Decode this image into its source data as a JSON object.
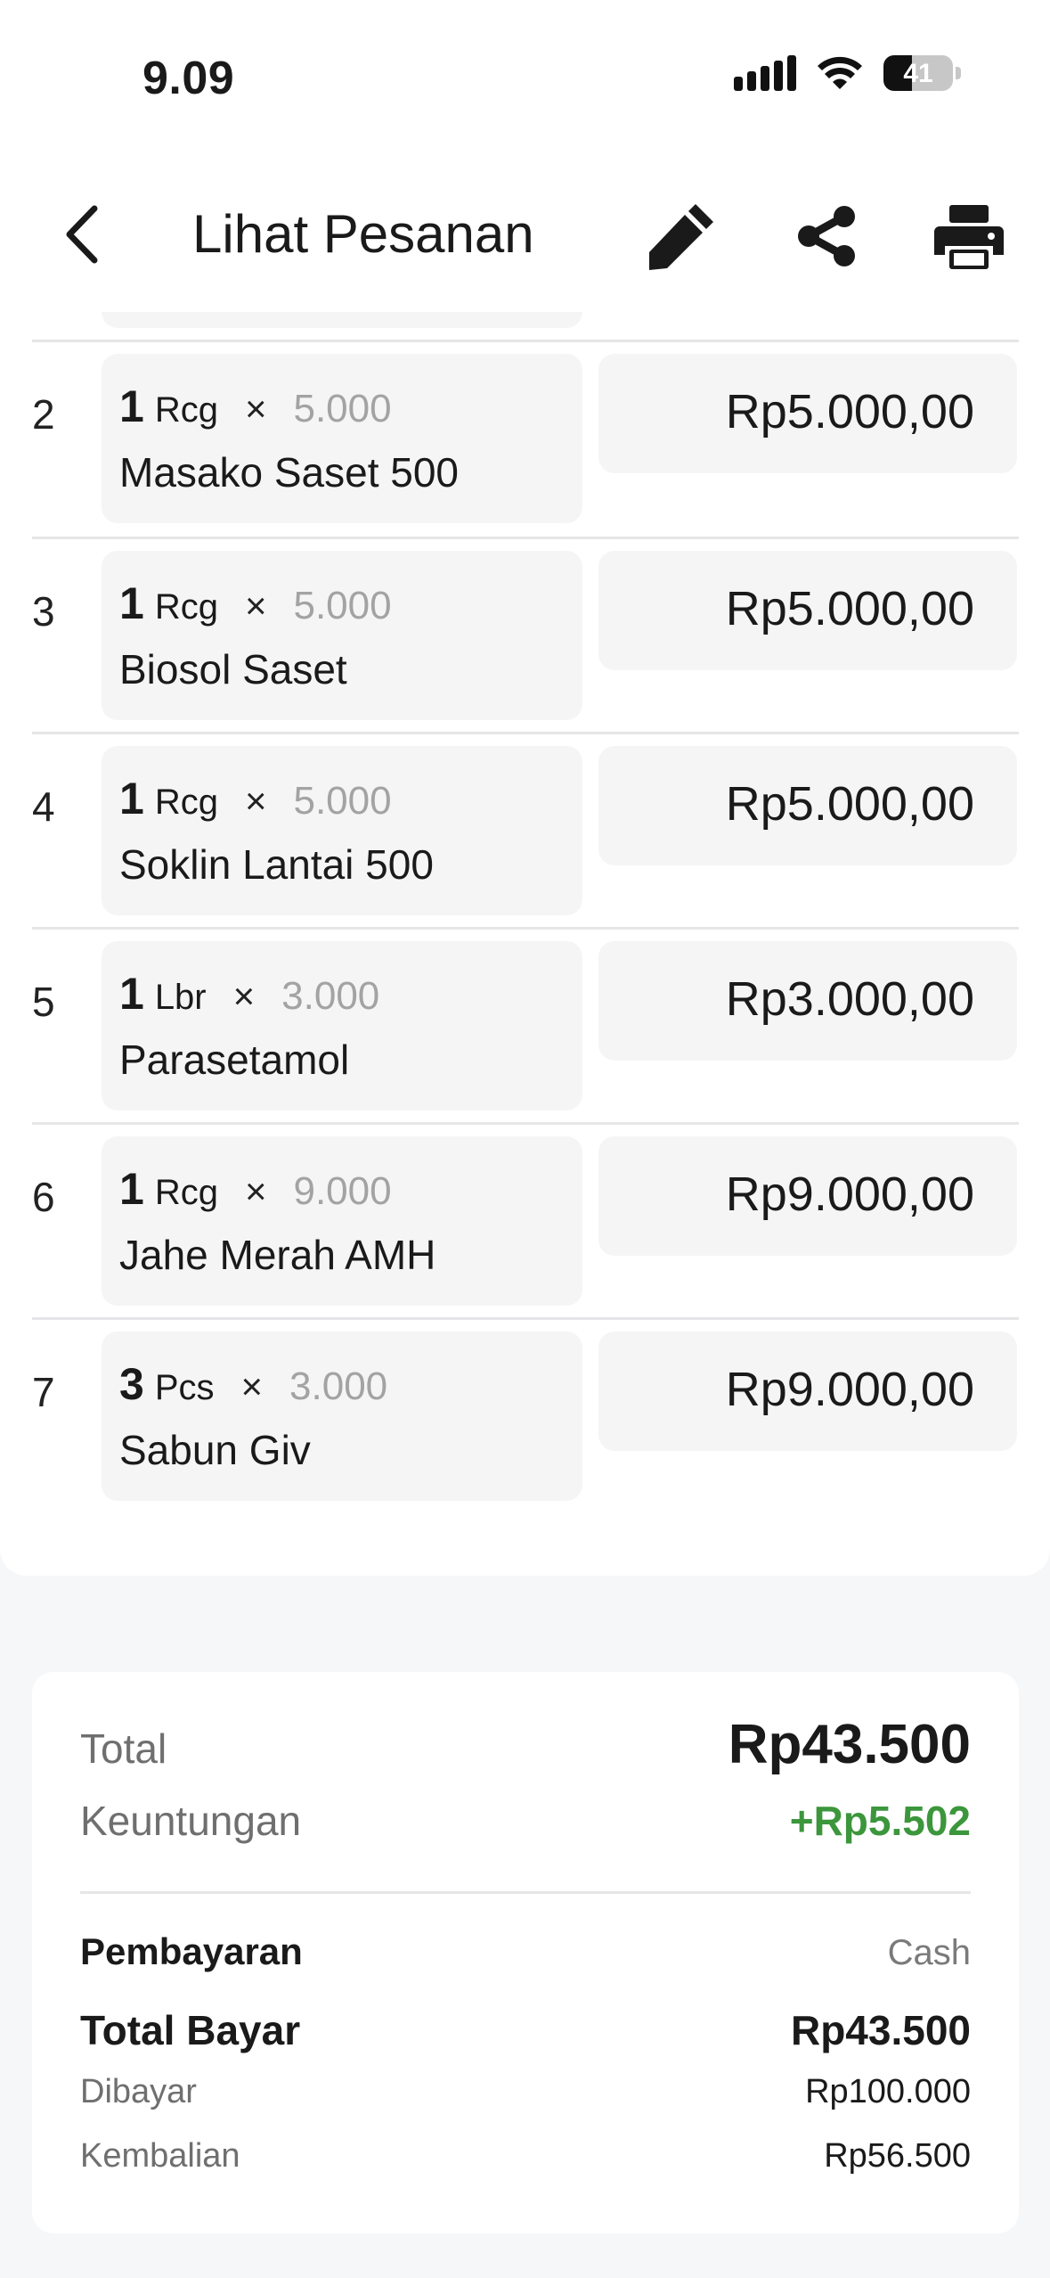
{
  "status_bar": {
    "time": "9.09",
    "battery": "41",
    "battery_level": 0.41
  },
  "header": {
    "title": "Lihat Pesanan"
  },
  "items": [
    {
      "no": "2",
      "qty": "1",
      "unit": "Rcg",
      "times": "×",
      "price": "5.000",
      "name": "Masako Saset 500",
      "subtotal": "Rp5.000,00"
    },
    {
      "no": "3",
      "qty": "1",
      "unit": "Rcg",
      "times": "×",
      "price": "5.000",
      "name": "Biosol Saset",
      "subtotal": "Rp5.000,00"
    },
    {
      "no": "4",
      "qty": "1",
      "unit": "Rcg",
      "times": "×",
      "price": "5.000",
      "name": "Soklin Lantai 500",
      "subtotal": "Rp5.000,00"
    },
    {
      "no": "5",
      "qty": "1",
      "unit": "Lbr",
      "times": "×",
      "price": "3.000",
      "name": "Parasetamol",
      "subtotal": "Rp3.000,00"
    },
    {
      "no": "6",
      "qty": "1",
      "unit": "Rcg",
      "times": "×",
      "price": "9.000",
      "name": "Jahe Merah AMH",
      "subtotal": "Rp9.000,00"
    },
    {
      "no": "7",
      "qty": "3",
      "unit": "Pcs",
      "times": "×",
      "price": "3.000",
      "name": "Sabun Giv",
      "subtotal": "Rp9.000,00"
    }
  ],
  "summary": {
    "total_label": "Total",
    "total_value": "Rp43.500",
    "profit_label": "Keuntungan",
    "profit_value": "+Rp5.502",
    "payment_label": "Pembayaran",
    "payment_value": "Cash",
    "total_paid_label": "Total Bayar",
    "total_paid_value": "Rp43.500",
    "paid_label": "Dibayar",
    "paid_value": "Rp100.000",
    "change_label": "Kembalian",
    "change_value": "Rp56.500"
  },
  "colors": {
    "profit": "#3c963c",
    "card_bg": "#f5f5f6",
    "page_bg": "#f6f7f9"
  },
  "icons": {
    "back": "chevron-left-icon",
    "edit": "pencil-icon",
    "share": "share-icon",
    "print": "printer-icon"
  }
}
